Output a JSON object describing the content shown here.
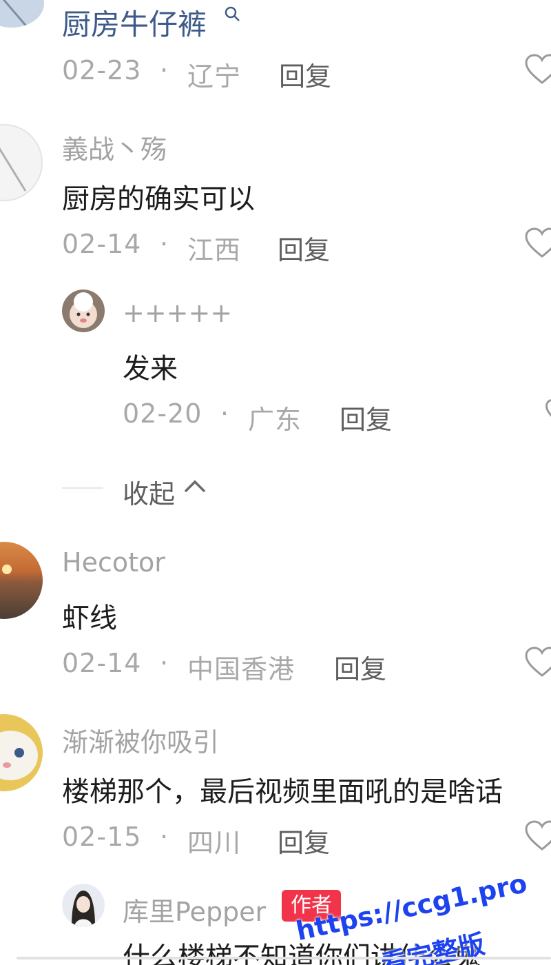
{
  "comments": [
    {
      "content": "厨房牛仔裤",
      "date": "02-23",
      "location": "辽宁",
      "reply_label": "回复"
    },
    {
      "username": "義战丶殇",
      "content": "厨房的确实可以",
      "date": "02-14",
      "location": "江西",
      "reply_label": "回复",
      "replies": [
        {
          "username": "+++++",
          "content": "发来",
          "date": "02-20",
          "location": "广东",
          "reply_label": "回复"
        }
      ],
      "collapse_label": "收起"
    },
    {
      "username": "Hecotor",
      "content": "虾线",
      "date": "02-14",
      "location": "中国香港",
      "reply_label": "回复"
    },
    {
      "username": "渐渐被你吸引",
      "content": "楼梯那个，最后视频里面吼的是啥话",
      "date": "02-15",
      "location": "四川",
      "reply_label": "回复",
      "replies": [
        {
          "username": "库里Pepper",
          "badge": "作者",
          "content": "什么楼梯不知道你们讲什么鬼"
        }
      ]
    }
  ],
  "separator": "·",
  "watermark": {
    "line1": "https://ccg1.pro",
    "line2": "看完整版"
  },
  "colors": {
    "link": "#3e5a8a",
    "badge": "#f2344a",
    "watermark": "#1d43f0"
  }
}
